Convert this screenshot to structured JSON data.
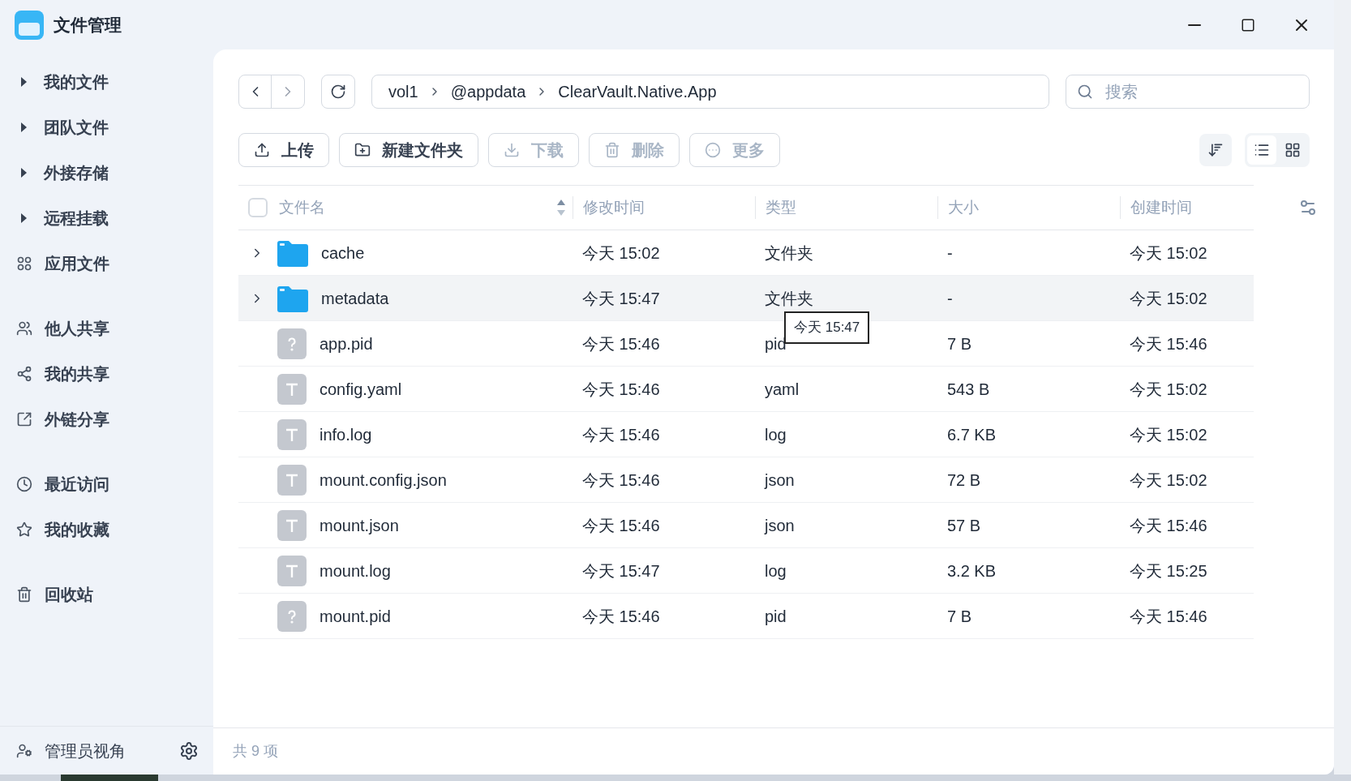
{
  "window": {
    "title": "文件管理"
  },
  "sidebar": {
    "groups": [
      {
        "items": [
          {
            "label": "我的文件",
            "kind": "tree"
          },
          {
            "label": "团队文件",
            "kind": "tree"
          },
          {
            "label": "外接存储",
            "kind": "tree"
          },
          {
            "label": "远程挂载",
            "kind": "tree"
          },
          {
            "label": "应用文件",
            "kind": "apps"
          }
        ]
      },
      {
        "items": [
          {
            "label": "他人共享",
            "kind": "people"
          },
          {
            "label": "我的共享",
            "kind": "share"
          },
          {
            "label": "外链分享",
            "kind": "link"
          }
        ]
      },
      {
        "items": [
          {
            "label": "最近访问",
            "kind": "clock"
          },
          {
            "label": "我的收藏",
            "kind": "star"
          }
        ]
      },
      {
        "items": [
          {
            "label": "回收站",
            "kind": "trash"
          }
        ]
      }
    ],
    "footer": {
      "label": "管理员视角"
    }
  },
  "breadcrumb": [
    "vol1",
    "@appdata",
    "ClearVault.Native.App"
  ],
  "search": {
    "placeholder": "搜索"
  },
  "toolbar": [
    {
      "label": "上传",
      "kind": "upload",
      "disabled": false
    },
    {
      "label": "新建文件夹",
      "kind": "folder",
      "disabled": false
    },
    {
      "label": "下载",
      "kind": "download",
      "disabled": true
    },
    {
      "label": "删除",
      "kind": "delete",
      "disabled": true
    },
    {
      "label": "更多",
      "kind": "more",
      "disabled": true
    }
  ],
  "view": {
    "list_selected": true
  },
  "table": {
    "select_all_checked": false,
    "columns": [
      "文件名",
      "修改时间",
      "类型",
      "大小",
      "创建时间"
    ],
    "rows": [
      {
        "kind": "folder",
        "name": "cache",
        "modified": "今天 15:02",
        "type": "文件夹",
        "size": "-",
        "created": "今天 15:02",
        "highlighted": false
      },
      {
        "kind": "folder",
        "name": "metadata",
        "modified": "今天 15:47",
        "type": "文件夹",
        "size": "-",
        "created": "今天 15:02",
        "highlighted": true
      },
      {
        "kind": "unknown",
        "name": "app.pid",
        "modified": "今天 15:46",
        "type": "pid",
        "size": "7 B",
        "created": "今天 15:46",
        "highlighted": false
      },
      {
        "kind": "text",
        "name": "config.yaml",
        "modified": "今天 15:46",
        "type": "yaml",
        "size": "543 B",
        "created": "今天 15:02",
        "highlighted": false
      },
      {
        "kind": "text",
        "name": "info.log",
        "modified": "今天 15:46",
        "type": "log",
        "size": "6.7 KB",
        "created": "今天 15:02",
        "highlighted": false
      },
      {
        "kind": "text",
        "name": "mount.config.json",
        "modified": "今天 15:46",
        "type": "json",
        "size": "72 B",
        "created": "今天 15:02",
        "highlighted": false
      },
      {
        "kind": "text",
        "name": "mount.json",
        "modified": "今天 15:46",
        "type": "json",
        "size": "57 B",
        "created": "今天 15:46",
        "highlighted": false
      },
      {
        "kind": "text",
        "name": "mount.log",
        "modified": "今天 15:47",
        "type": "log",
        "size": "3.2 KB",
        "created": "今天 15:25",
        "highlighted": false
      },
      {
        "kind": "unknown",
        "name": "mount.pid",
        "modified": "今天 15:46",
        "type": "pid",
        "size": "7 B",
        "created": "今天 15:46",
        "highlighted": false
      }
    ]
  },
  "tooltip": "今天 15:47",
  "status_bar": "共 9 项"
}
